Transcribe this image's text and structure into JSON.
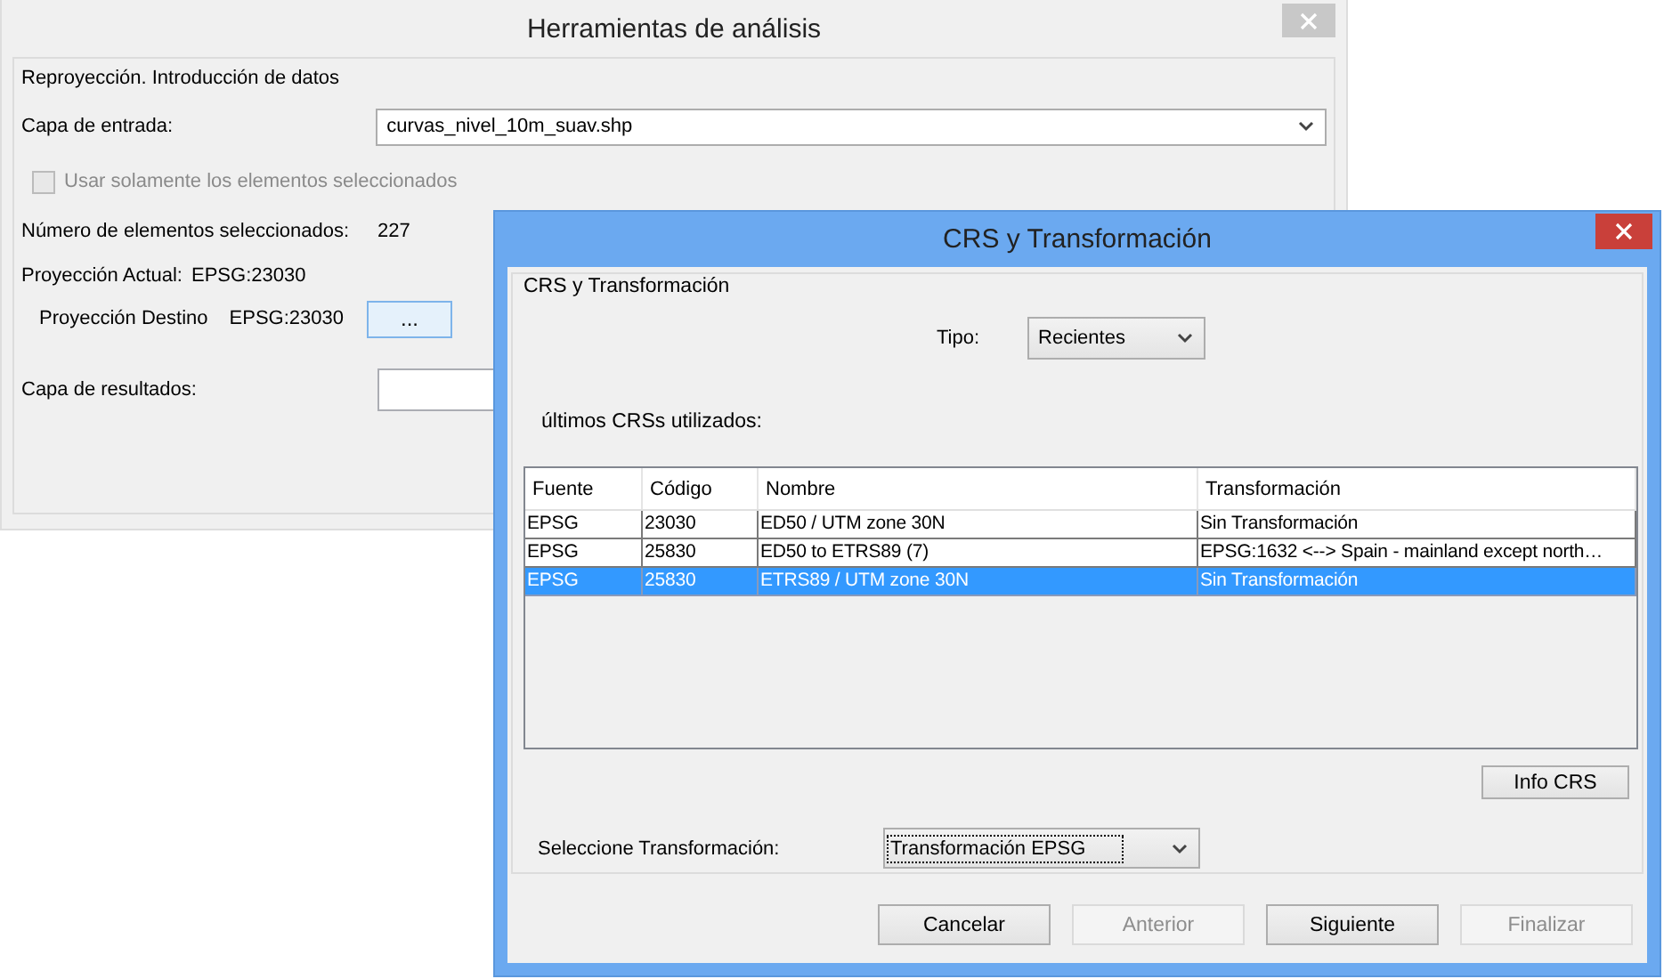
{
  "main_window": {
    "title": "Herramientas de análisis",
    "section_title": "Reproyección. Introducción de datos",
    "input_layer": {
      "label": "Capa de entrada:",
      "value": "curvas_nivel_10m_suav.shp"
    },
    "selection_checkbox": {
      "label": "Usar solamente los elementos seleccionados",
      "checked": false,
      "disabled": true
    },
    "selected_count": {
      "label": "Número de elementos seleccionados:",
      "value": "227"
    },
    "current_projection": {
      "label": "Proyección Actual:",
      "value": "EPSG:23030"
    },
    "target_projection": {
      "label": "Proyección Destino",
      "value": "EPSG:23030",
      "button": "..."
    },
    "output_layer": {
      "label": "Capa de resultados:"
    }
  },
  "dialog": {
    "title": "CRS y Transformación",
    "group_title": "CRS y Transformación",
    "type": {
      "label": "Tipo:",
      "value": "Recientes"
    },
    "recent_label": "últimos CRSs utilizados:",
    "table": {
      "columns": [
        "Fuente",
        "Código",
        "Nombre",
        "Transformación"
      ],
      "rows": [
        {
          "cells": [
            "EPSG",
            "23030",
            "ED50 / UTM zone 30N",
            "Sin Transformación"
          ],
          "selected": false
        },
        {
          "cells": [
            "EPSG",
            "25830",
            "ED50 to ETRS89 (7)",
            "EPSG:1632 <--> Spain - mainland except north…"
          ],
          "selected": false
        },
        {
          "cells": [
            "EPSG",
            "25830",
            "ETRS89 / UTM zone 30N",
            "Sin Transformación"
          ],
          "selected": true
        }
      ]
    },
    "info_button": "Info CRS",
    "transformation": {
      "label": "Seleccione Transformación:",
      "value": "Transformación EPSG"
    },
    "buttons": [
      {
        "label": "Cancelar",
        "disabled": false
      },
      {
        "label": "Anterior",
        "disabled": true
      },
      {
        "label": "Siguiente",
        "disabled": false
      },
      {
        "label": "Finalizar",
        "disabled": true
      }
    ]
  }
}
